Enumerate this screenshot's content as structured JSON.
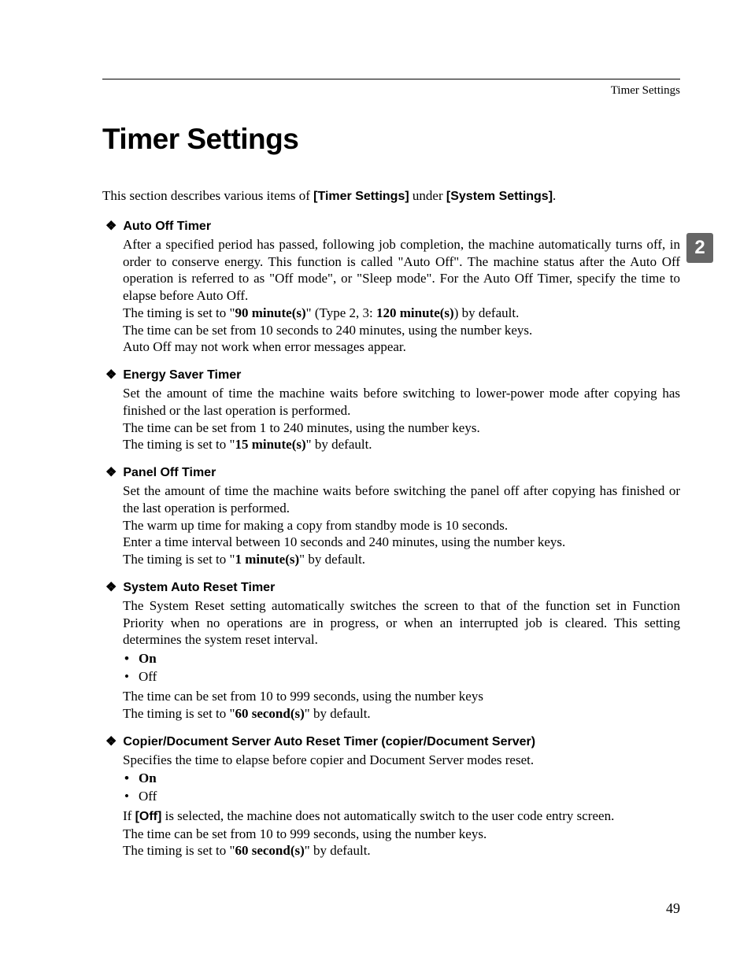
{
  "header": "Timer Settings",
  "tab": "2",
  "title": "Timer Settings",
  "intro_pre": "This section describes various items of ",
  "intro_b1": "[Timer Settings]",
  "intro_mid": " under ",
  "intro_b2": "[System Settings]",
  "intro_post": ".",
  "sections": {
    "s1": {
      "title": "Auto Off Timer",
      "p1": "After a specified period has passed, following job completion, the machine automatically turns off, in order to conserve energy. This function is called \"Auto Off\". The machine status after the Auto Off operation is referred to as \"Off mode\", or \"Sleep mode\". For the Auto Off Timer, specify the time to elapse before Auto Off.",
      "p2_pre": "The timing is set to \"",
      "p2_b1": "90 minute(s)",
      "p2_mid": "\" (Type 2, 3: ",
      "p2_b2": "120 minute(s)",
      "p2_post": ") by default.",
      "p3": "The time can be set from 10 seconds to 240 minutes, using the number keys.",
      "p4": "Auto Off may not work when error messages appear."
    },
    "s2": {
      "title": "Energy Saver Timer",
      "p1": "Set the amount of time the machine waits before switching to lower-power mode after copying has finished or the last operation is performed.",
      "p2": "The time can be set from 1 to 240 minutes, using the number keys.",
      "p3_pre": "The timing is set to \"",
      "p3_b": "15 minute(s)",
      "p3_post": "\" by default."
    },
    "s3": {
      "title": "Panel Off Timer",
      "p1": "Set the amount of time the machine waits before switching the panel off after copying has finished or the last operation is performed.",
      "p2": "The warm up time for making a copy from standby mode is 10 seconds.",
      "p3": "Enter a time interval between 10 seconds and 240 minutes, using the number keys.",
      "p4_pre": "The timing is set to \"",
      "p4_b": "1 minute(s)",
      "p4_post": "\" by default."
    },
    "s4": {
      "title": "System Auto Reset Timer",
      "p1": "The System Reset setting automatically switches the screen to that of the function set in Function Priority when no operations are in progress, or when an interrupted job is cleared. This setting determines the system reset interval.",
      "opt_on": "On",
      "opt_off": "Off",
      "p2": "The time can be set from 10 to 999 seconds, using the number keys",
      "p3_pre": "The timing is set to \"",
      "p3_b": "60 second(s)",
      "p3_post": "\" by default."
    },
    "s5": {
      "title": "Copier/Document Server Auto Reset Timer (copier/Document Server)",
      "p1": "Specifies the time to elapse before copier and Document Server modes reset.",
      "opt_on": "On",
      "opt_off": "Off",
      "p2_pre": "If ",
      "p2_b": "[Off]",
      "p2_post": " is selected, the machine does not automatically switch to the user code entry screen.",
      "p3": "The time can be set from 10 to 999 seconds, using the number keys.",
      "p4_pre": "The timing is set to \"",
      "p4_b": "60 second(s)",
      "p4_post": "\" by default."
    }
  },
  "page_number": "49"
}
